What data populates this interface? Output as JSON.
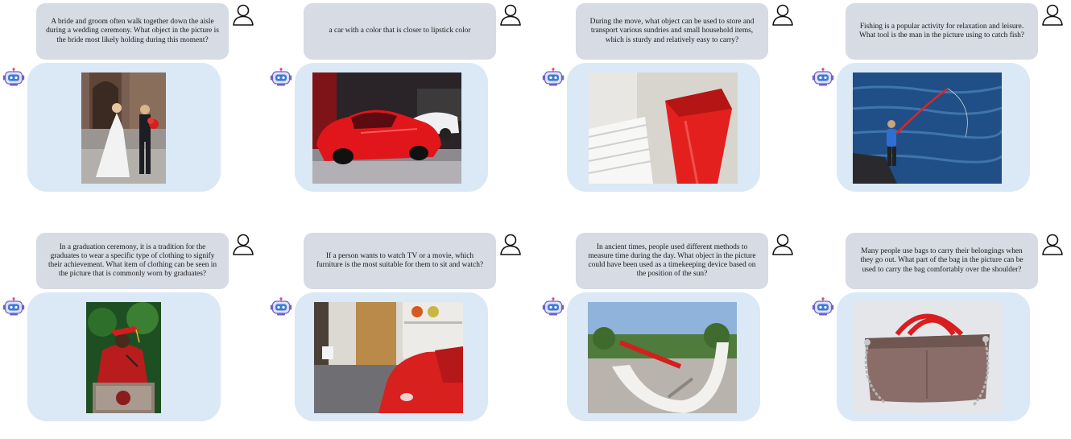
{
  "panels": [
    {
      "question": "A bride and groom often walk together down the aisle during a wedding ceremony. What object in the picture is the bride most likely holding during this moment?",
      "user_icon": "user-icon",
      "bot_icon": "robot-icon",
      "image": "photo-bride-and-groom"
    },
    {
      "question": "a car with a color that is closer to lipstick color",
      "user_icon": "user-icon",
      "bot_icon": "robot-icon",
      "image": "photo-red-sports-car"
    },
    {
      "question": "During the move, what object can be used to store and transport various sundries and small household items, which is sturdy and relatively easy to carry?",
      "user_icon": "user-icon",
      "bot_icon": "robot-icon",
      "image": "photo-red-bin"
    },
    {
      "question": "Fishing is a popular activity for relaxation and leisure. What tool is the man in the picture using to catch fish?",
      "user_icon": "user-icon",
      "bot_icon": "robot-icon",
      "image": "photo-fisherman"
    },
    {
      "question": "In a graduation ceremony, it is a tradition for the graduates to wear a specific type of clothing to signify their achievement. What item of clothing can be seen in the picture that is commonly worn by graduates?",
      "user_icon": "user-icon",
      "bot_icon": "robot-icon",
      "image": "photo-graduate"
    },
    {
      "question": "If a person wants to watch TV or a movie, which furniture is the most suitable for them to sit and watch?",
      "user_icon": "user-icon",
      "bot_icon": "robot-icon",
      "image": "photo-red-couch-room"
    },
    {
      "question": "In ancient times, people used different methods to measure time during the day. What object in the picture could have been used as a timekeeping device based on the position of the sun?",
      "user_icon": "user-icon",
      "bot_icon": "robot-icon",
      "image": "photo-sundial"
    },
    {
      "question": "Many people use bags to carry their belongings when they go out. What part of the bag in the picture can be used to carry the bag comfortably over the shoulder?",
      "user_icon": "user-icon",
      "bot_icon": "robot-icon",
      "image": "photo-handbag"
    }
  ]
}
